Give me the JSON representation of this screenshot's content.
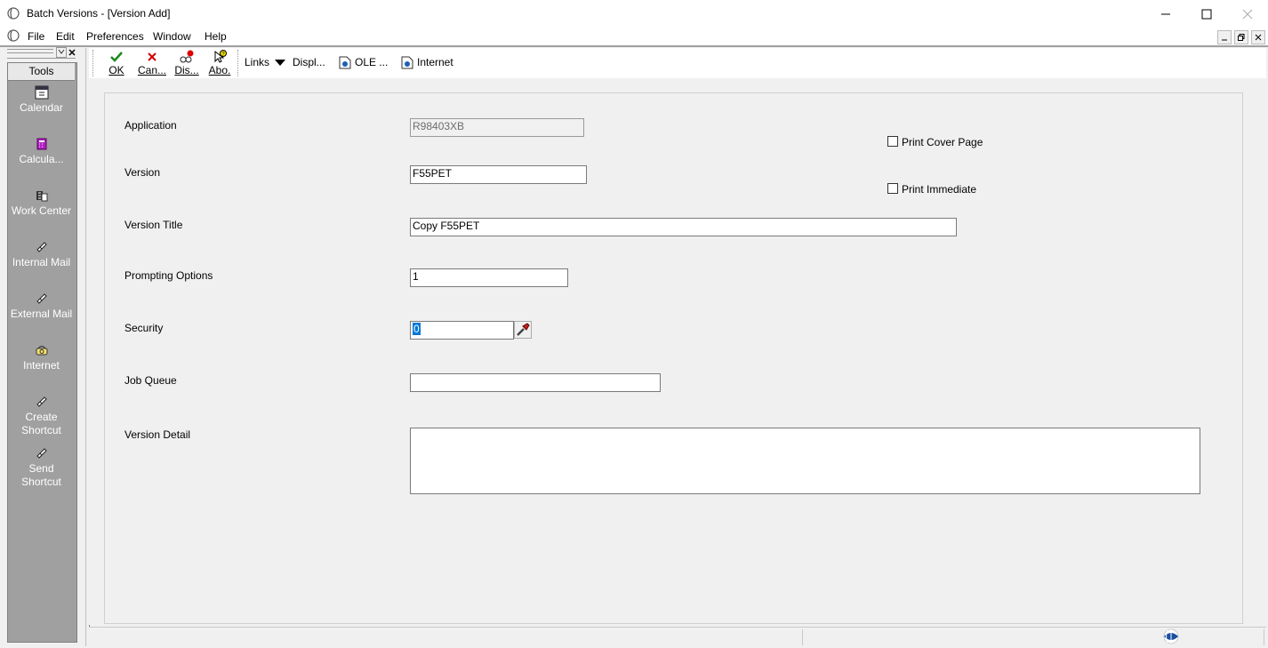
{
  "window": {
    "title": "Batch Versions - [Version Add]"
  },
  "menu": {
    "items": [
      "File",
      "Edit",
      "Preferences",
      "Window",
      "Help"
    ]
  },
  "tools": {
    "header": "Tools",
    "items": [
      {
        "label": "Calendar",
        "icon": "calendar-icon"
      },
      {
        "label": "Calcula...",
        "icon": "calculator-icon"
      },
      {
        "label": "Work Center",
        "icon": "work-center-icon"
      },
      {
        "label": "Internal Mail",
        "icon": "internal-mail-icon"
      },
      {
        "label": "External Mail",
        "icon": "external-mail-icon"
      },
      {
        "label": "Internet",
        "icon": "internet-icon"
      },
      {
        "label": "Create Shortcut",
        "icon": "create-shortcut-icon"
      },
      {
        "label": "Send Shortcut",
        "icon": "send-shortcut-icon"
      }
    ]
  },
  "toolbar": {
    "ok": "OK",
    "cancel": "Can...",
    "display": "Dis...",
    "about": "Abo.",
    "links": "Links",
    "display_menu": "Displ...",
    "ole": "OLE ...",
    "internet": "Internet"
  },
  "form": {
    "application_label": "Application",
    "application_value": "R98403XB",
    "version_label": "Version",
    "version_value": "F55PET",
    "version_title_label": "Version Title",
    "version_title_value": "Copy F55PET",
    "prompting_label": "Prompting Options",
    "prompting_value": "1",
    "security_label": "Security",
    "security_value": "0",
    "job_queue_label": "Job Queue",
    "job_queue_value": "",
    "version_detail_label": "Version Detail",
    "version_detail_value": "",
    "print_cover_label": "Print Cover Page",
    "print_immediate_label": "Print Immediate"
  },
  "colors": {
    "accent_check": "#1a8a1a",
    "cancel_red": "#d00000",
    "tools_bg": "#a0a0a0"
  }
}
